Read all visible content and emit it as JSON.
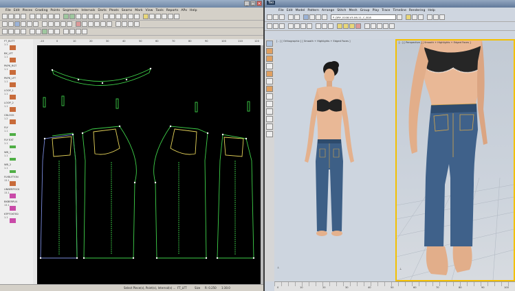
{
  "left_window": {
    "title": "",
    "controls": [
      "_",
      "□",
      "×"
    ],
    "menu": [
      "File",
      "Edit",
      "Pieces",
      "Grading",
      "Points",
      "Segments",
      "Internals",
      "Darts",
      "Pleats",
      "Seams",
      "Mark",
      "View",
      "Tools",
      "Reports",
      "APx",
      "Help"
    ],
    "pieces": [
      {
        "label": "FT_BUTT",
        "num": "1.1",
        "thumb": "orange"
      },
      {
        "label": "BK_LFT",
        "num": "1.1",
        "thumb": "orange"
      },
      {
        "label": "PKPK_RGT",
        "num": "1.1",
        "thumb": "orange"
      },
      {
        "label": "PKPK_LFT",
        "num": "1.1",
        "thumb": "orange"
      },
      {
        "label": "LOOP_1",
        "num": "1.1",
        "thumb": "orange"
      },
      {
        "label": "LOOP_2",
        "num": "1.1",
        "thumb": "orange"
      },
      {
        "label": "CBLOCK",
        "num": "1.2",
        "thumb": "orange"
      },
      {
        "label": "FLY",
        "num": "1.1",
        "thumb": "green"
      },
      {
        "label": "FLY EXT",
        "num": "1.1",
        "thumb": "green"
      },
      {
        "label": "WB_1",
        "num": "1.1",
        "thumb": "green"
      },
      {
        "label": "WB_2",
        "num": "1.1",
        "thumb": "green"
      },
      {
        "label": "FLYBUTTON",
        "num": "13.1",
        "thumb": "orange"
      },
      {
        "label": "UNBERPOCK",
        "num": "13.1",
        "thumb": "magenta"
      },
      {
        "label": "BKBERPLN",
        "num": "13.1",
        "thumb": "magenta"
      },
      {
        "label": "KTPTOKTED",
        "num": "1.1",
        "thumb": "magenta"
      }
    ],
    "ruler_marks": [
      "-10",
      "0",
      "10",
      "20",
      "30",
      "40",
      "50",
      "60",
      "70",
      "80",
      "90",
      "100",
      "110",
      "120"
    ],
    "status": {
      "hint": "Select Piece(s), Point(s), Internal(s) ...",
      "piece": "FT_LFT",
      "size": "Size",
      "zoom": "R: 0.250",
      "scale": "1:30.0"
    }
  },
  "right_window": {
    "app_badge": "Tao",
    "menu": [
      "File",
      "Edit",
      "Model",
      "Pattern",
      "Arrange",
      "Stitch",
      "Mesh",
      "Group",
      "Play",
      "Trace",
      "Timeline",
      "Rendering",
      "Help"
    ],
    "preset_combo": "P_DRY_0108-V3-06-11_C_B18",
    "viewport_left_label": "[ - ] [ Orthographic ] [ Smooth + Highlights + Edged Faces ]",
    "viewport_right_label": "[ - ] [ Perspective ] [ Smooth + Highlights + Edged Faces ]",
    "timeline_values": [
      "0",
      "10",
      "20",
      "30",
      "40",
      "50",
      "60",
      "70",
      "80",
      "90",
      "100"
    ]
  },
  "colors": {
    "canvas_bg": "#000000",
    "pattern_line": "#3fd24a",
    "pattern_point": "#ffffff",
    "selection_yellow": "#f3c000",
    "denim": "#3d5f86",
    "skin": "#e9b896"
  }
}
